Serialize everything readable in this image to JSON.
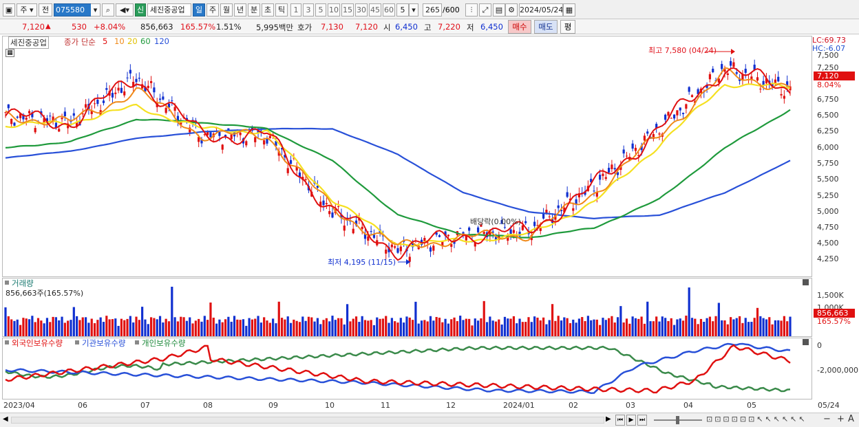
{
  "toolbar": {
    "market_label": "주",
    "prev_label": "전",
    "code": "075580",
    "stock_name": "세진중공업",
    "badge": "신",
    "periods": [
      "일",
      "주",
      "월",
      "년",
      "분",
      "초",
      "틱"
    ],
    "active_period": "일",
    "intervals": [
      "1",
      "3",
      "5",
      "10",
      "15",
      "30",
      "45",
      "60"
    ],
    "interval_value": "5",
    "count": "265",
    "count_max": "/600",
    "date": "2024/05/24"
  },
  "quote": {
    "price": "7,120",
    "change_arrow": "▲",
    "change": "530",
    "change_pct": "+8.04%",
    "volume": "856,663",
    "volume_ratio": "165.57%",
    "turnover": "1.51%",
    "amount": "5,995백만",
    "bid_label": "호가",
    "bid1": "7,130",
    "bid2": "7,120",
    "open_label": "시",
    "open": "6,450",
    "high_label": "고",
    "high": "7,220",
    "low_label": "저",
    "low": "6,450",
    "buy_label": "매수",
    "sell_label": "매도",
    "eval_label": "평"
  },
  "price_panel": {
    "legend_name": "세진중공업",
    "legend_ma_prefix": "종가 단순",
    "ma_labels": [
      "5",
      "10",
      "20",
      "60",
      "120"
    ],
    "annotation_high": "최고 7,580 (04/24)",
    "annotation_low": "최저 4,195 (11/15)",
    "annotation_dividend": "배당락(0.00%)",
    "lc_label": "LC:69.73",
    "hc_label": "HC:-6.07",
    "current_price_tag": "7,120",
    "current_pct_tag": "8.04%",
    "yticks": [
      "7,500",
      "7,250",
      "7,000",
      "6,750",
      "6,500",
      "6,250",
      "6,000",
      "5,750",
      "5,500",
      "5,250",
      "5,000",
      "4,750",
      "4,500",
      "4,250"
    ]
  },
  "volume_panel": {
    "title": "거래량",
    "value_line": "856,663주(165.57%)",
    "yticks": [
      "1,500K",
      "1,000K"
    ],
    "current_tag": "856,663",
    "current_pct_tag": "165.57%"
  },
  "holding_panel": {
    "legend": [
      "외국인보유수량",
      "기관보유수량",
      "개인보유수량"
    ],
    "yticks": [
      "0",
      "-2,000,000"
    ]
  },
  "xaxis": [
    "2023/04",
    "06",
    "07",
    "08",
    "09",
    "10",
    "11",
    "12",
    "2024/01",
    "02",
    "03",
    "04",
    "05",
    "05/24"
  ],
  "colors": {
    "ma5": "#e01010",
    "ma10": "#f08a1a",
    "ma20": "#f5e020",
    "ma60": "#1f9a3c",
    "ma120": "#2850d8",
    "up": "#e01010",
    "down": "#1030d0"
  },
  "chart_data": [
    {
      "type": "line",
      "title": "세진중공업",
      "x": [
        "2023/04",
        "06",
        "07",
        "08",
        "09",
        "10",
        "11",
        "12",
        "2024/01",
        "02",
        "03",
        "04",
        "05"
      ],
      "series": [
        {
          "name": "5",
          "values": [
            6500,
            6400,
            7100,
            6200,
            6200,
            5000,
            4400,
            4650,
            4700,
            5400,
            6300,
            7250,
            6900
          ]
        },
        {
          "name": "10",
          "values": [
            6500,
            6400,
            6900,
            6200,
            6200,
            5050,
            4450,
            4600,
            4650,
            5300,
            6200,
            7150,
            6950
          ]
        },
        {
          "name": "20",
          "values": [
            6350,
            6400,
            6650,
            6300,
            6250,
            5200,
            4500,
            4550,
            4650,
            5150,
            6050,
            7000,
            6950
          ]
        },
        {
          "name": "60",
          "values": [
            6000,
            6100,
            6450,
            6400,
            6300,
            5800,
            4950,
            4650,
            4600,
            4750,
            5200,
            6000,
            6600
          ]
        },
        {
          "name": "120",
          "values": [
            5850,
            5950,
            6150,
            6250,
            6300,
            6300,
            5900,
            5300,
            5000,
            4900,
            4950,
            5300,
            5800
          ]
        }
      ],
      "ylim": [
        4100,
        7700
      ]
    }
  ]
}
